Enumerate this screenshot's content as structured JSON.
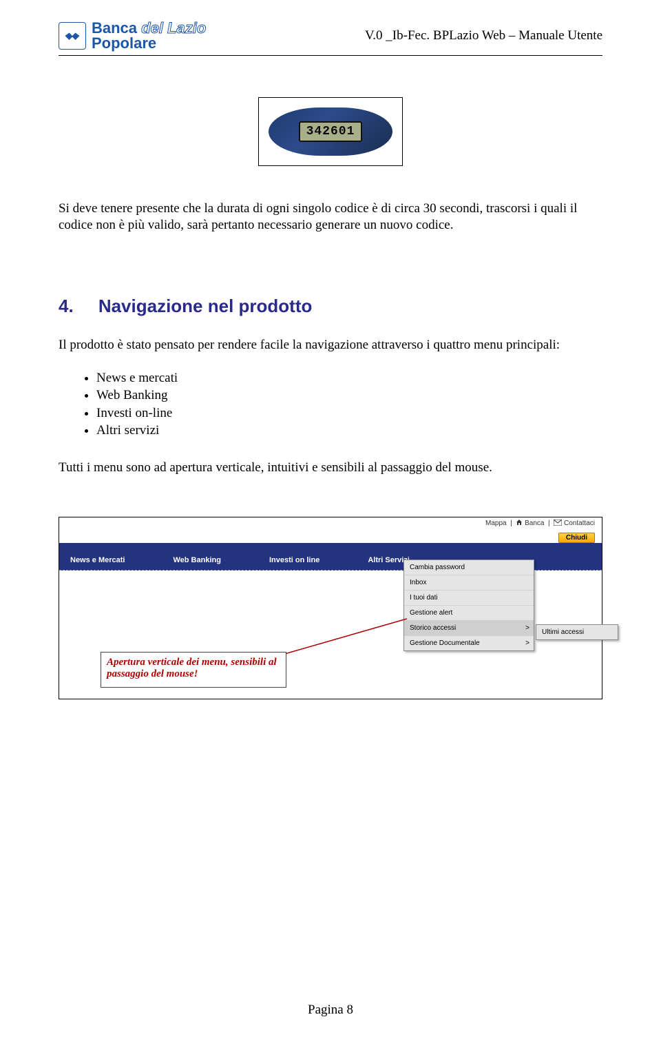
{
  "header": {
    "logo_line1a": "Banca ",
    "logo_line1b": "del Lazio",
    "logo_line2": "Popolare",
    "doc_title": "V.0 _Ib-Fec. BPLazio Web – Manuale Utente"
  },
  "token": {
    "code": "342601"
  },
  "paragraph1": "Si deve tenere presente che la durata di ogni singolo codice è di circa 30 secondi, trascorsi i quali il codice non è più valido, sarà pertanto necessario generare un nuovo codice.",
  "section": {
    "number": "4.",
    "title": "Navigazione nel prodotto"
  },
  "intro": "Il prodotto è stato pensato per rendere facile la navigazione attraverso i quattro menu principali:",
  "menus": [
    "News e mercati",
    "Web Banking",
    "Investi on-line",
    "Altri servizi"
  ],
  "closing": "Tutti i menu sono ad apertura verticale, intuitivi e sensibili al passaggio del mouse.",
  "app": {
    "top_links": {
      "mappa": "Mappa",
      "banca": "Banca",
      "contattaci": "Contattaci"
    },
    "close_label": "Chiudi",
    "menubar": [
      "News e Mercati",
      "Web Banking",
      "Investi on line",
      "Altri Servizi"
    ],
    "dropdown": [
      "Cambia password",
      "Inbox",
      "I tuoi dati",
      "Gestione alert",
      "Storico accessi",
      "Gestione Documentale"
    ],
    "flyout": "Ultimi accessi",
    "callout": "Apertura verticale dei menu, sensibili al passaggio del mouse!"
  },
  "footer": "Pagina 8"
}
